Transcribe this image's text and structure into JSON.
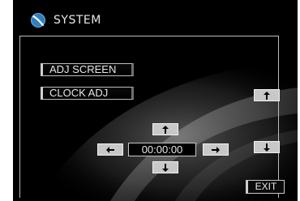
{
  "header": {
    "title": "SYSTEM",
    "icon": "globe-icon"
  },
  "menu": {
    "adj_screen_label": "ADJ SCREEN",
    "clock_adj_label": "CLOCK ADJ"
  },
  "clock": {
    "time": "00:00:00"
  },
  "controls": {
    "up_icon": "up-arrow-icon",
    "down_icon": "down-arrow-icon",
    "left_icon": "left-arrow-icon",
    "right_icon": "right-arrow-icon"
  },
  "footer": {
    "exit_label": "EXIT"
  },
  "colors": {
    "background": "#000000",
    "text": "#e8e8e8",
    "border": "#bdbdbd",
    "button_face": "#c8c8c8",
    "globe_blue": "#2f7fc0"
  }
}
